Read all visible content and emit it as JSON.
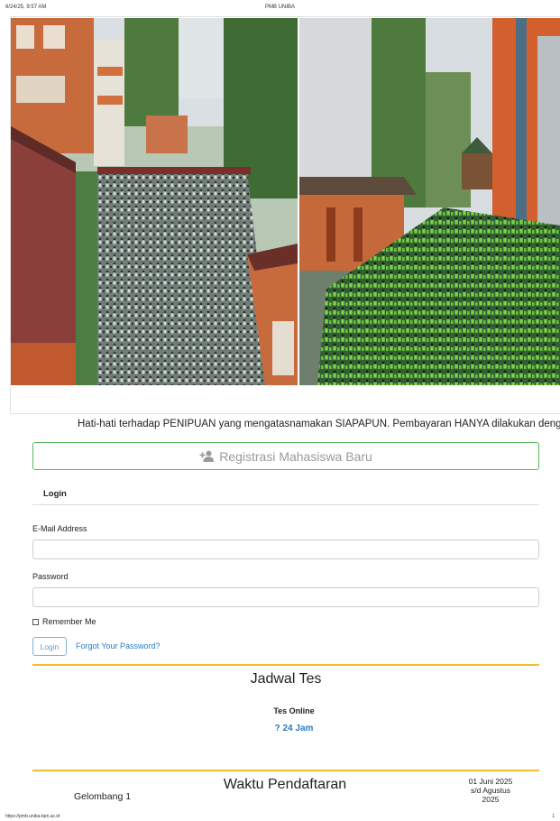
{
  "print_header": {
    "datetime": "6/24/25, 9:57 AM",
    "page_title": "PMB UNIBA"
  },
  "print_footer": {
    "url": "https://pmb.uniba-bpn.ac.id",
    "page_number": "1"
  },
  "banner": {
    "photos": [
      "photo-left",
      "photo-right"
    ]
  },
  "marquee": {
    "text": "Hati-hati terhadap PENIPUAN yang mengatasnamakan SIAPAPUN. Pembayaran HANYA dilakukan denga"
  },
  "register": {
    "label": "Registrasi Mahasiswa Baru",
    "icon": "user-plus-icon"
  },
  "login": {
    "tab_label": "Login",
    "email_label": "E-Mail Address",
    "email_value": "",
    "password_label": "Password",
    "password_value": "",
    "remember_label": "Remember Me",
    "button_label": "Login",
    "forgot_label": "Forgot Your Password?"
  },
  "schedule": {
    "title": "Jadwal Tes",
    "subtitle": "Tes Online",
    "time": "? 24 Jam"
  },
  "registration_period": {
    "title": "Waktu Pendaftaran",
    "wave": "Gelombang 1",
    "date_line1": "01 Juni 2025",
    "date_line2": "s/d Agustus",
    "date_line3": "2025"
  },
  "colors": {
    "accent_gold": "#f0c030",
    "success_green": "#5cb85c",
    "link_blue": "#2a7bc0"
  }
}
